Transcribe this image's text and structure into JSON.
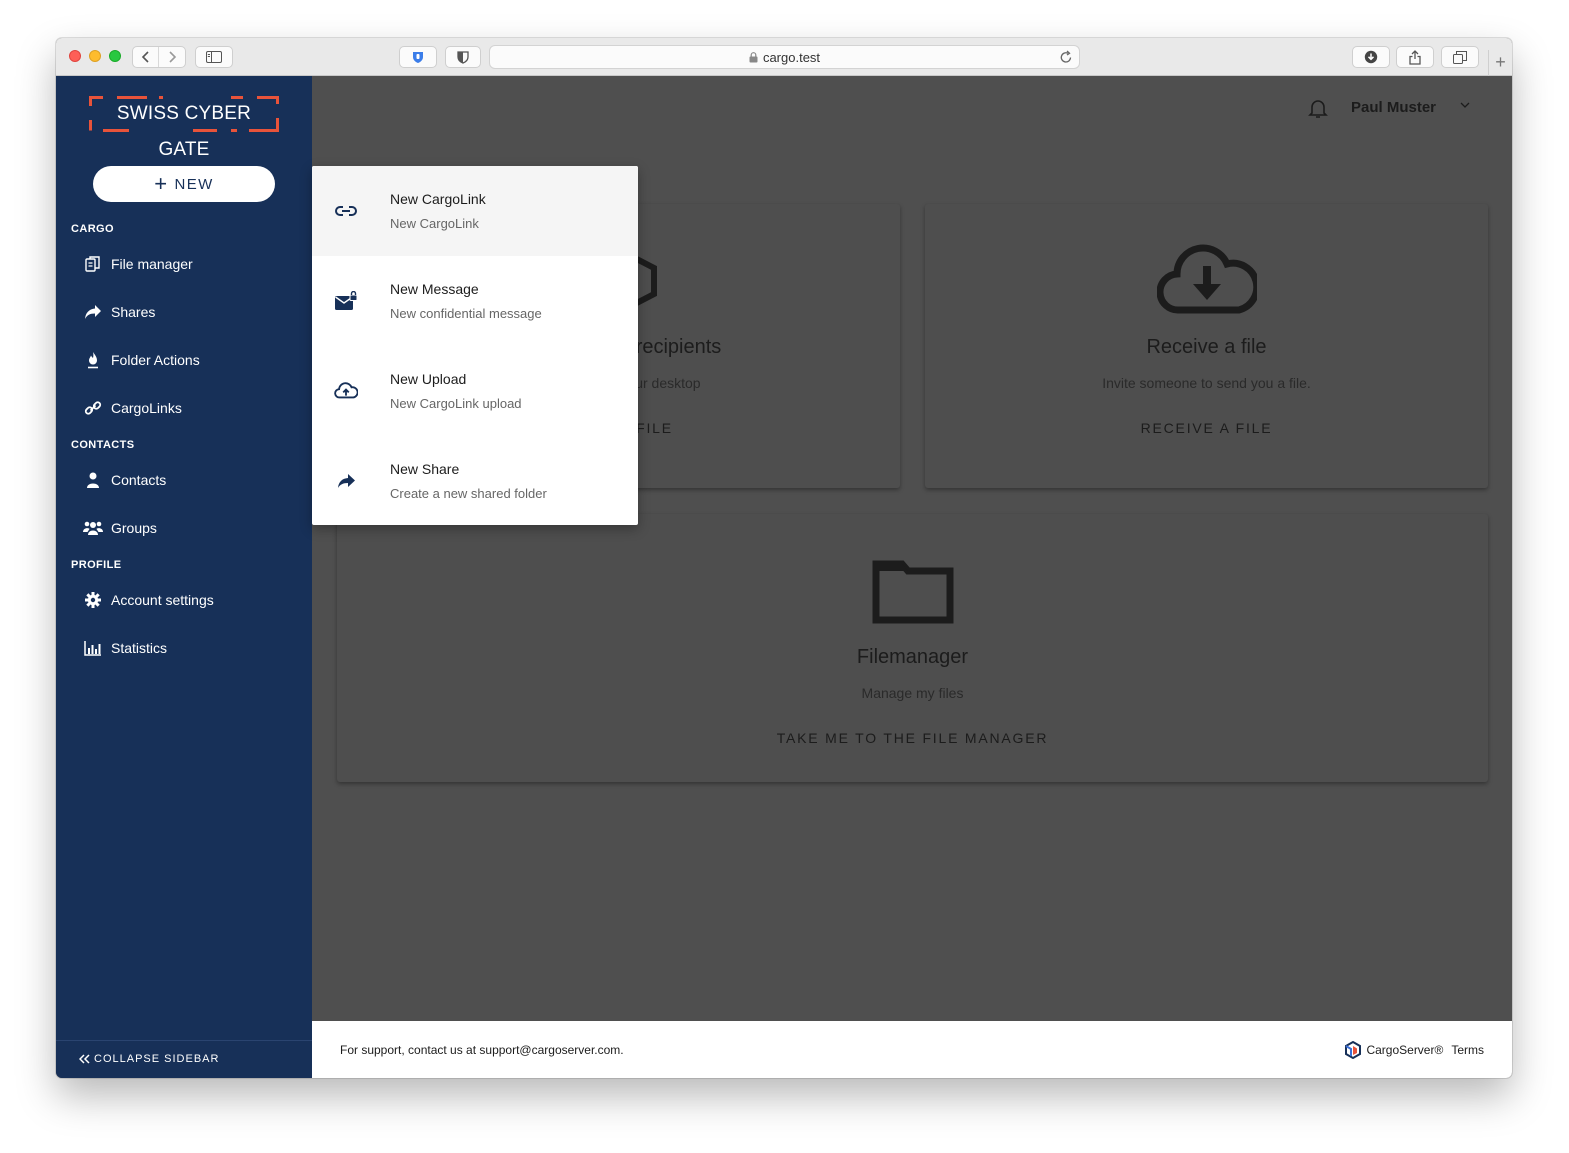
{
  "browser": {
    "url": "cargo.test"
  },
  "sidebar": {
    "logo_text": "SWISS CYBER GATE",
    "new_button": "NEW",
    "sections": {
      "cargo": "CARGO",
      "contacts": "CONTACTS",
      "profile": "PROFILE"
    },
    "items": {
      "file_manager": "File manager",
      "shares": "Shares",
      "folder_actions": "Folder Actions",
      "cargolinks": "CargoLinks",
      "contacts": "Contacts",
      "groups": "Groups",
      "account_settings": "Account settings",
      "statistics": "Statistics"
    },
    "collapse": "COLLAPSE SIDEBAR"
  },
  "header": {
    "user_name": "Paul Muster"
  },
  "cards": {
    "send": {
      "title": "recipients",
      "desc": "your desktop",
      "action": "FILE"
    },
    "receive": {
      "title": "Receive a file",
      "desc": "Invite someone to send you a file.",
      "action": "RECEIVE A FILE"
    },
    "filemanager": {
      "title": "Filemanager",
      "desc": "Manage my files",
      "action": "TAKE ME TO THE FILE MANAGER"
    }
  },
  "menu": {
    "items": [
      {
        "title": "New CargoLink",
        "subtitle": "New CargoLink",
        "icon": "link-icon"
      },
      {
        "title": "New Message",
        "subtitle": "New confidential message",
        "icon": "secure-mail-icon"
      },
      {
        "title": "New Upload",
        "subtitle": "New CargoLink upload",
        "icon": "cloud-upload-icon"
      },
      {
        "title": "New Share",
        "subtitle": "Create a new shared folder",
        "icon": "share-icon"
      }
    ]
  },
  "footer": {
    "support": "For support, contact us at support@cargoserver.com.",
    "brand": "CargoServer®",
    "terms": "Terms"
  },
  "colors": {
    "sidebar_bg": "#173058",
    "logo_accent": "#e8533a",
    "overlay_bg": "#4f4f4f"
  }
}
